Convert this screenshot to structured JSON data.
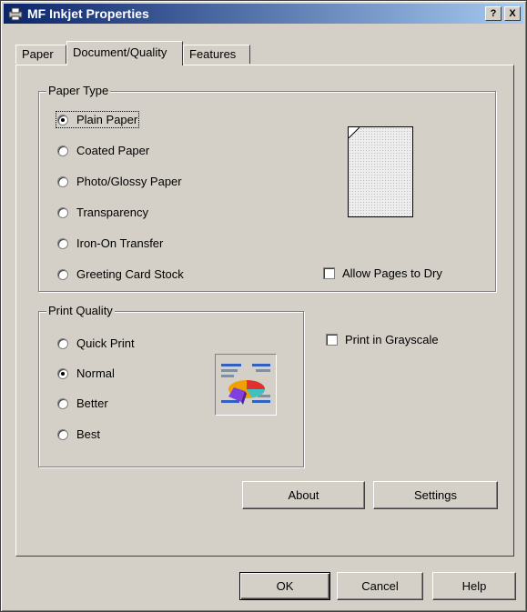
{
  "window": {
    "title": "MF Inkjet Properties",
    "help_button": "?",
    "close_button": "X"
  },
  "tabs": [
    {
      "label": "Paper"
    },
    {
      "label": "Document/Quality"
    },
    {
      "label": "Features"
    }
  ],
  "paper_type": {
    "legend": "Paper Type",
    "options": [
      {
        "label": "Plain Paper",
        "selected": true
      },
      {
        "label": "Coated Paper",
        "selected": false
      },
      {
        "label": "Photo/Glossy Paper",
        "selected": false
      },
      {
        "label": "Transparency",
        "selected": false
      },
      {
        "label": "Iron-On Transfer",
        "selected": false
      },
      {
        "label": "Greeting Card Stock",
        "selected": false
      }
    ],
    "allow_dry_label": "Allow Pages to Dry"
  },
  "print_quality": {
    "legend": "Print Quality",
    "options": [
      {
        "label": "Quick Print",
        "selected": false
      },
      {
        "label": "Normal",
        "selected": true
      },
      {
        "label": "Better",
        "selected": false
      },
      {
        "label": "Best",
        "selected": false
      }
    ]
  },
  "grayscale_label": "Print in Grayscale",
  "buttons": {
    "about": "About",
    "settings": "Settings",
    "ok": "OK",
    "cancel": "Cancel",
    "help": "Help"
  },
  "colors": {
    "titlebar_start": "#0a246a",
    "titlebar_end": "#a6caf0",
    "face": "#d4d0c8"
  }
}
